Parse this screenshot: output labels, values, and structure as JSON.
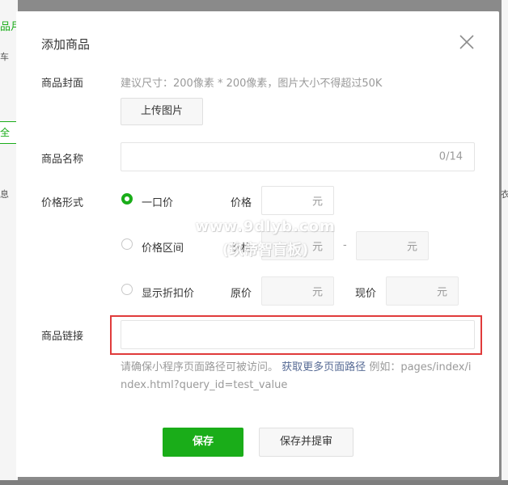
{
  "background": {
    "frag_top": "品月",
    "frag_side": "车",
    "frag_tab": "全部",
    "frag_row": "息",
    "frag_right": "衣"
  },
  "dialog": {
    "title": "添加商品",
    "close_icon": "close-icon"
  },
  "cover": {
    "label": "商品封面",
    "hint": "建议尺寸：200像素 * 200像素，图片大小不得超过50K",
    "upload_button": "上传图片"
  },
  "name": {
    "label": "商品名称",
    "value": "",
    "counter": "0/14"
  },
  "price": {
    "label": "价格形式",
    "options": [
      {
        "label": "一口价",
        "checked": true
      },
      {
        "label": "价格区间",
        "checked": false
      },
      {
        "label": "显示折扣价",
        "checked": false
      }
    ],
    "fixed_caption": "价格",
    "fixed_unit": "元",
    "range_caption": "价格",
    "range_unit_a": "元",
    "range_dash": "-",
    "range_unit_b": "元",
    "orig_caption": "原价",
    "orig_unit": "元",
    "now_caption": "现价",
    "now_unit": "元"
  },
  "link": {
    "label": "商品链接",
    "value": "",
    "hint_text": "请确保小程序页面路径可被访问。",
    "hint_link": "获取更多页面路径",
    "hint_example": "例如：pages/index/index.html?query_id=test_value"
  },
  "actions": {
    "save": "保存",
    "save_submit": "保存并提审"
  },
  "watermark": {
    "line1": "www.9dlyb.com",
    "line2": "(玖帝智盲板)"
  },
  "colors": {
    "primary": "#1aad19",
    "highlight": "#e03b3b",
    "link": "#576b95"
  }
}
